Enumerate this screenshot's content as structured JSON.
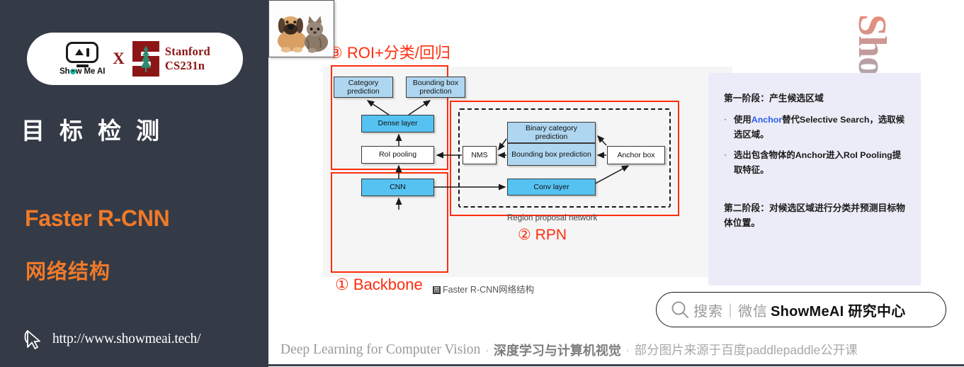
{
  "left_panel": {
    "brand": {
      "showmeai_word": "Show Me AI",
      "cross": "X",
      "stanford_line1": "Stanford",
      "stanford_line2": "CS231n"
    },
    "title_cn": "目标检测",
    "subtitle_en": "Faster R-CNN",
    "subtitle_cn": "网络结构",
    "site_url": "http://www.showmeai.tech/",
    "colors": {
      "background": "#343b47",
      "accent": "#F07A28",
      "stanford_red": "#8C1515"
    }
  },
  "diagram": {
    "heading_roi": "③ ROI+分类/回归",
    "label_backbone": "① Backbone",
    "label_rpn": "② RPN",
    "label_rpn_sub": "Region proposal network",
    "caption": "图 Faster R-CNN网络结构",
    "caption_mark": "图",
    "nodes": {
      "category_prediction": "Category prediction",
      "bounding_box_prediction_top": "Bounding box prediction",
      "dense_layer": "Dense layer",
      "roi_pooling": "RoI pooling",
      "cnn": "CNN",
      "nms": "NMS",
      "binary_category_prediction": "Binary category prediction",
      "bounding_box_prediction_rpn": "Bounding box prediction",
      "anchor_box": "Anchor box",
      "conv_layer": "Conv layer"
    },
    "colors": {
      "frame_red": "#FF2D0E",
      "node_light_blue": "#AFD6F0",
      "node_mid_blue": "#55C2F2",
      "panel_bg": "#f5f5f5"
    }
  },
  "text_panel": {
    "stage1_head": "第一阶段：产生候选区域",
    "bullets": [
      {
        "marker": "·",
        "pre": "使用",
        "highlight": "Anchor",
        "post": "替代Selective Search，选取候选区域。"
      },
      {
        "marker": "·",
        "pre": "",
        "highlight": "",
        "post": "选出包含物体的Anchor进入RoI Pooling提取特征。"
      }
    ],
    "stage2_para": "第二阶段：对候选区域进行分类并预测目标物体位置。",
    "colors": {
      "background": "#ECECF8",
      "highlight": "#2B5BE8"
    }
  },
  "watermark": {
    "text": "ShowMeAI"
  },
  "search_bar": {
    "icon": "search-icon",
    "placeholder": "搜索｜微信",
    "brand": "ShowMeAI 研究中心"
  },
  "footer": {
    "english": "Deep Learning for Computer Vision",
    "sep1": "·",
    "chinese_bold": "深度学习与计算机视觉",
    "sep2": "·",
    "chinese_note": "部分图片来源于百度paddlepaddle公开课"
  }
}
